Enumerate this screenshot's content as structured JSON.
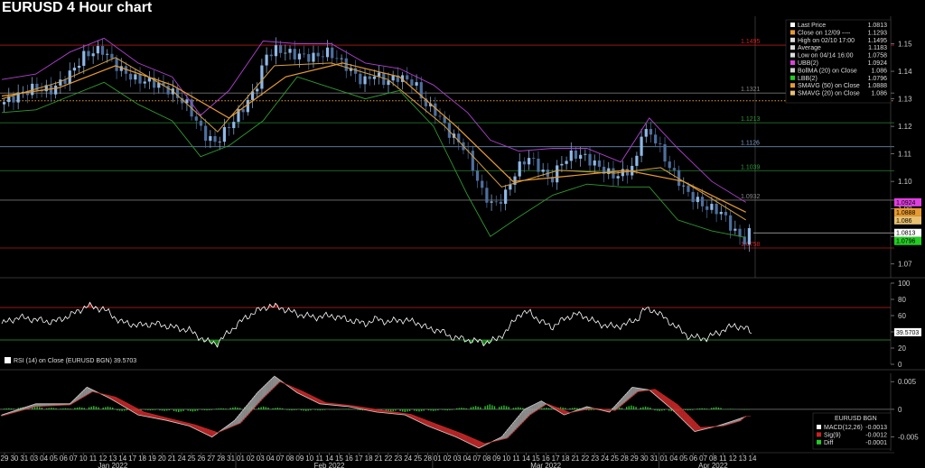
{
  "title": "EURUSD 4 Hour chart",
  "colors": {
    "bg": "#000000",
    "candle_up": "#8fb8e6",
    "candle_dn": "#4d6f9e",
    "bb": "#b040d0",
    "lbb": "#2e9a2e",
    "sma50": "#e89a30",
    "sma20": "#d9a040",
    "close_line": "#e89a30",
    "resistance": "#cc2020",
    "support": "#2f9a3a",
    "rsi_line": "#ffffff",
    "macd": "#aaaaaa",
    "sig": "#c82828",
    "diff": "#22c022"
  },
  "legend": {
    "items": [
      {
        "label": "Last Price",
        "value": "1.0813",
        "color": "#ffffff"
      },
      {
        "label": "Close on 12/09 ----",
        "value": "1.1293",
        "color": "#e89a30"
      },
      {
        "label": "High on 02/10 17:00",
        "value": "1.1495",
        "color": "#dddddd"
      },
      {
        "label": "Average",
        "value": "1.1183",
        "color": "#dddddd"
      },
      {
        "label": "Low on 04/14 16:00",
        "value": "1.0758",
        "color": "#dddddd"
      },
      {
        "label": "UBB(2)",
        "value": "1.0924",
        "color": "#e040e0"
      },
      {
        "label": "BollMA (20)  on Close",
        "value": "1.086",
        "color": "#d0d0d0"
      },
      {
        "label": "LBB(2)",
        "value": "1.0796",
        "color": "#22cc22"
      },
      {
        "label": "SMAVG (50)  on Close",
        "value": "1.0888",
        "color": "#e89a30"
      },
      {
        "label": "SMAVG (20)  on Close",
        "value": "1.086",
        "color": "#e8c070"
      }
    ]
  },
  "rsi_label": "RSI (14)  on Close (EURUSD BGN) 39.5703",
  "rsi_value_tag": "39.5703",
  "macd_legend": {
    "title": "EURUSD BGN",
    "items": [
      {
        "label": "MACD(12,26)",
        "value": "-0.0013",
        "color": "#ffffff"
      },
      {
        "label": "Sig(9)",
        "value": "-0.0012",
        "color": "#cc2020"
      },
      {
        "label": "Diff",
        "value": "-0.0001",
        "color": "#22cc22"
      }
    ]
  },
  "chart_data": [
    {
      "type": "candlestick",
      "title": "EURUSD 4 Hour chart",
      "ylim": [
        1.065,
        1.16
      ],
      "yticks": [
        "1.15",
        "1.14",
        "1.13",
        "1.12",
        "1.11",
        "1.10",
        "1.09",
        "1.08",
        "1.07"
      ],
      "ytick_values": [
        1.15,
        1.14,
        1.13,
        1.12,
        1.11,
        1.1,
        1.09,
        1.08,
        1.07
      ],
      "horizontal_levels": [
        {
          "label": "1.1495",
          "value": 1.1495,
          "color": "#cc2020"
        },
        {
          "label": "1.1321",
          "value": 1.1321,
          "color": "#888888"
        },
        {
          "label": "1.1213",
          "value": 1.1213,
          "color": "#2f9a3a"
        },
        {
          "label": "1.1126",
          "value": 1.1126,
          "color": "#7aa0c8"
        },
        {
          "label": "1.1039",
          "value": 1.1039,
          "color": "#2f9a3a"
        },
        {
          "label": "1.0932",
          "value": 1.0932,
          "color": "#888888"
        },
        {
          "label": "1.0758",
          "value": 1.0758,
          "color": "#cc2020"
        }
      ],
      "close_dotted": 1.1293,
      "last_price": 1.0813,
      "right_tags": [
        {
          "label": "1.0924",
          "value": 1.0924,
          "color": "#e040e0"
        },
        {
          "label": "1.0888",
          "value": 1.0888,
          "color": "#e89a30"
        },
        {
          "label": "1.086",
          "value": 1.086,
          "color": "#e8c070"
        },
        {
          "label": "1.0813",
          "value": 1.0813,
          "color": "#ffffff"
        },
        {
          "label": "1.0796",
          "value": 1.0796,
          "color": "#22cc22"
        }
      ],
      "price_path": [
        [
          0,
          1.128
        ],
        [
          6,
          1.131
        ],
        [
          12,
          1.134
        ],
        [
          18,
          1.133
        ],
        [
          24,
          1.138
        ],
        [
          30,
          1.146
        ],
        [
          36,
          1.148
        ],
        [
          42,
          1.141
        ],
        [
          48,
          1.137
        ],
        [
          54,
          1.136
        ],
        [
          60,
          1.133
        ],
        [
          66,
          1.128
        ],
        [
          72,
          1.117
        ],
        [
          76,
          1.114
        ],
        [
          80,
          1.119
        ],
        [
          86,
          1.127
        ],
        [
          90,
          1.133
        ],
        [
          94,
          1.146
        ],
        [
          98,
          1.148
        ],
        [
          104,
          1.146
        ],
        [
          110,
          1.145
        ],
        [
          116,
          1.147
        ],
        [
          122,
          1.142
        ],
        [
          128,
          1.136
        ],
        [
          132,
          1.139
        ],
        [
          136,
          1.136
        ],
        [
          140,
          1.138
        ],
        [
          146,
          1.136
        ],
        [
          150,
          1.128
        ],
        [
          154,
          1.125
        ],
        [
          158,
          1.118
        ],
        [
          164,
          1.112
        ],
        [
          170,
          1.096
        ],
        [
          174,
          1.091
        ],
        [
          178,
          1.095
        ],
        [
          182,
          1.104
        ],
        [
          186,
          1.109
        ],
        [
          190,
          1.105
        ],
        [
          194,
          1.1
        ],
        [
          198,
          1.107
        ],
        [
          202,
          1.11
        ],
        [
          206,
          1.109
        ],
        [
          210,
          1.106
        ],
        [
          216,
          1.102
        ],
        [
          220,
          1.103
        ],
        [
          224,
          1.106
        ],
        [
          226,
          1.118
        ],
        [
          230,
          1.117
        ],
        [
          236,
          1.105
        ],
        [
          242,
          1.096
        ],
        [
          248,
          1.091
        ],
        [
          254,
          1.089
        ],
        [
          258,
          1.083
        ],
        [
          262,
          1.078
        ],
        [
          264,
          1.0813
        ]
      ],
      "ubb_path": [
        [
          0,
          1.137
        ],
        [
          12,
          1.139
        ],
        [
          24,
          1.147
        ],
        [
          36,
          1.152
        ],
        [
          48,
          1.143
        ],
        [
          60,
          1.138
        ],
        [
          70,
          1.124
        ],
        [
          80,
          1.133
        ],
        [
          92,
          1.151
        ],
        [
          104,
          1.15
        ],
        [
          116,
          1.15
        ],
        [
          128,
          1.143
        ],
        [
          140,
          1.141
        ],
        [
          152,
          1.135
        ],
        [
          164,
          1.125
        ],
        [
          172,
          1.115
        ],
        [
          182,
          1.111
        ],
        [
          194,
          1.112
        ],
        [
          206,
          1.112
        ],
        [
          218,
          1.107
        ],
        [
          228,
          1.123
        ],
        [
          238,
          1.112
        ],
        [
          250,
          1.1
        ],
        [
          262,
          1.0924
        ]
      ],
      "lbb_path": [
        [
          0,
          1.125
        ],
        [
          12,
          1.126
        ],
        [
          24,
          1.131
        ],
        [
          36,
          1.136
        ],
        [
          48,
          1.128
        ],
        [
          60,
          1.122
        ],
        [
          70,
          1.109
        ],
        [
          80,
          1.113
        ],
        [
          92,
          1.122
        ],
        [
          104,
          1.138
        ],
        [
          116,
          1.134
        ],
        [
          128,
          1.13
        ],
        [
          140,
          1.133
        ],
        [
          152,
          1.12
        ],
        [
          164,
          1.095
        ],
        [
          172,
          1.08
        ],
        [
          182,
          1.087
        ],
        [
          194,
          1.095
        ],
        [
          206,
          1.099
        ],
        [
          218,
          1.098
        ],
        [
          228,
          1.098
        ],
        [
          238,
          1.086
        ],
        [
          250,
          1.082
        ],
        [
          262,
          1.0796
        ]
      ],
      "sma50_path": [
        [
          0,
          1.131
        ],
        [
          20,
          1.134
        ],
        [
          40,
          1.142
        ],
        [
          60,
          1.135
        ],
        [
          80,
          1.123
        ],
        [
          100,
          1.138
        ],
        [
          120,
          1.143
        ],
        [
          140,
          1.138
        ],
        [
          160,
          1.12
        ],
        [
          180,
          1.1
        ],
        [
          200,
          1.102
        ],
        [
          220,
          1.104
        ],
        [
          240,
          1.1
        ],
        [
          262,
          1.0888
        ]
      ],
      "sma20_path": [
        [
          0,
          1.13
        ],
        [
          20,
          1.136
        ],
        [
          40,
          1.145
        ],
        [
          60,
          1.133
        ],
        [
          76,
          1.118
        ],
        [
          96,
          1.142
        ],
        [
          116,
          1.143
        ],
        [
          136,
          1.137
        ],
        [
          156,
          1.12
        ],
        [
          176,
          1.098
        ],
        [
          196,
          1.104
        ],
        [
          216,
          1.103
        ],
        [
          232,
          1.105
        ],
        [
          248,
          1.095
        ],
        [
          262,
          1.086
        ]
      ]
    },
    {
      "type": "line",
      "title": "RSI (14)  on Close (EURUSD BGN) 39.5703",
      "ylim": [
        0,
        100
      ],
      "yticks": [
        "100",
        "80",
        "60",
        "40",
        "20",
        "0"
      ],
      "ytick_values": [
        100,
        80,
        60,
        40,
        20,
        0
      ],
      "levels": [
        {
          "value": 70,
          "color": "#cc2020"
        },
        {
          "value": 30,
          "color": "#2f9a3a"
        }
      ],
      "path": [
        [
          0,
          50
        ],
        [
          6,
          58
        ],
        [
          12,
          55
        ],
        [
          18,
          52
        ],
        [
          24,
          60
        ],
        [
          30,
          72
        ],
        [
          36,
          68
        ],
        [
          42,
          52
        ],
        [
          48,
          48
        ],
        [
          54,
          50
        ],
        [
          60,
          46
        ],
        [
          66,
          42
        ],
        [
          72,
          28
        ],
        [
          76,
          26
        ],
        [
          80,
          40
        ],
        [
          86,
          58
        ],
        [
          90,
          66
        ],
        [
          94,
          72
        ],
        [
          98,
          70
        ],
        [
          104,
          62
        ],
        [
          110,
          58
        ],
        [
          116,
          60
        ],
        [
          122,
          55
        ],
        [
          128,
          50
        ],
        [
          132,
          56
        ],
        [
          136,
          52
        ],
        [
          140,
          55
        ],
        [
          146,
          52
        ],
        [
          150,
          44
        ],
        [
          154,
          42
        ],
        [
          158,
          34
        ],
        [
          164,
          30
        ],
        [
          170,
          27
        ],
        [
          174,
          30
        ],
        [
          178,
          42
        ],
        [
          182,
          62
        ],
        [
          186,
          64
        ],
        [
          190,
          52
        ],
        [
          194,
          46
        ],
        [
          198,
          56
        ],
        [
          202,
          62
        ],
        [
          206,
          58
        ],
        [
          210,
          50
        ],
        [
          216,
          46
        ],
        [
          220,
          50
        ],
        [
          224,
          56
        ],
        [
          226,
          68
        ],
        [
          230,
          66
        ],
        [
          236,
          50
        ],
        [
          242,
          34
        ],
        [
          248,
          32
        ],
        [
          254,
          42
        ],
        [
          258,
          48
        ],
        [
          262,
          44
        ],
        [
          264,
          39.57
        ]
      ]
    },
    {
      "type": "bar",
      "title": "EURUSD BGN",
      "ylim": [
        -0.0075,
        0.0065
      ],
      "yticks": [
        "0.005",
        "0",
        "-0.005"
      ],
      "ytick_values": [
        0.005,
        0,
        -0.005
      ],
      "macd_path": [
        [
          0,
          -0.001
        ],
        [
          12,
          0.001
        ],
        [
          24,
          0.001
        ],
        [
          30,
          0.004
        ],
        [
          38,
          0.002
        ],
        [
          48,
          -0.001
        ],
        [
          58,
          -0.002
        ],
        [
          66,
          -0.003
        ],
        [
          74,
          -0.005
        ],
        [
          82,
          -0.002
        ],
        [
          90,
          0.003
        ],
        [
          96,
          0.006
        ],
        [
          104,
          0.003
        ],
        [
          112,
          0.001
        ],
        [
          122,
          0.0005
        ],
        [
          132,
          -0.0005
        ],
        [
          142,
          -0.001
        ],
        [
          150,
          -0.003
        ],
        [
          160,
          -0.005
        ],
        [
          168,
          -0.007
        ],
        [
          176,
          -0.005
        ],
        [
          184,
          0.0
        ],
        [
          190,
          0.0015
        ],
        [
          198,
          -0.001
        ],
        [
          206,
          0.0005
        ],
        [
          214,
          -0.0005
        ],
        [
          222,
          0.004
        ],
        [
          228,
          0.0035
        ],
        [
          236,
          0.0
        ],
        [
          244,
          -0.004
        ],
        [
          252,
          -0.003
        ],
        [
          258,
          -0.002
        ],
        [
          262,
          -0.0013
        ]
      ],
      "sig_path": [
        [
          0,
          -0.0012
        ],
        [
          12,
          0.0005
        ],
        [
          24,
          0.0008
        ],
        [
          32,
          0.0032
        ],
        [
          40,
          0.0022
        ],
        [
          50,
          -0.0005
        ],
        [
          60,
          -0.0018
        ],
        [
          68,
          -0.0028
        ],
        [
          76,
          -0.0042
        ],
        [
          84,
          -0.0025
        ],
        [
          92,
          0.002
        ],
        [
          98,
          0.005
        ],
        [
          106,
          0.0032
        ],
        [
          114,
          0.0012
        ],
        [
          124,
          0.0006
        ],
        [
          134,
          -0.0002
        ],
        [
          144,
          -0.0009
        ],
        [
          152,
          -0.0025
        ],
        [
          162,
          -0.0044
        ],
        [
          170,
          -0.0062
        ],
        [
          178,
          -0.0052
        ],
        [
          186,
          -0.001
        ],
        [
          192,
          0.001
        ],
        [
          200,
          -0.0006
        ],
        [
          208,
          0.0002
        ],
        [
          216,
          -0.0002
        ],
        [
          224,
          0.0032
        ],
        [
          230,
          0.0036
        ],
        [
          238,
          0.0008
        ],
        [
          246,
          -0.0033
        ],
        [
          254,
          -0.003
        ],
        [
          260,
          -0.0021
        ],
        [
          262,
          -0.0012
        ]
      ],
      "diff": [
        0.0002,
        0.0004,
        0.0005,
        0.0003,
        0.0002,
        0.0004,
        0.0006,
        0.0005,
        -0.0003,
        -0.0004,
        -0.0002,
        -0.0003,
        -0.0005,
        -0.0004,
        -0.0002,
        0.0002,
        0.0004,
        0.0006,
        0.0005,
        0.0003,
        -0.0002,
        -0.0003,
        -0.0002,
        -0.0001,
        0.0001,
        -0.0002,
        -0.0003,
        -0.0004,
        -0.0005,
        -0.0004,
        -0.0003,
        -0.0002,
        0.0003,
        0.0006,
        0.0009,
        0.0007,
        0.0004,
        -0.0002,
        0.0003,
        0.0004,
        0.0003,
        -0.0002,
        -0.0001,
        0.0004,
        0.0007,
        0.0005,
        -0.0003,
        -0.0004,
        -0.0002,
        0.0002,
        0.0004,
        0.0001,
        -0.0001
      ]
    }
  ],
  "x_axis": {
    "days": [
      "29",
      "30",
      "31",
      "03",
      "04",
      "05",
      "06",
      "07",
      "10",
      "11",
      "12",
      "13",
      "14",
      "17",
      "18",
      "19",
      "20",
      "21",
      "24",
      "25",
      "26",
      "27",
      "28",
      "31",
      "01",
      "02",
      "03",
      "04",
      "07",
      "08",
      "09",
      "10",
      "11",
      "14",
      "15",
      "16",
      "17",
      "18",
      "21",
      "22",
      "23",
      "24",
      "25",
      "28",
      "01",
      "02",
      "03",
      "04",
      "07",
      "08",
      "09",
      "10",
      "11",
      "14",
      "15",
      "16",
      "17",
      "18",
      "21",
      "22",
      "23",
      "24",
      "25",
      "28",
      "29",
      "30",
      "31",
      "01",
      "04",
      "05",
      "06",
      "07",
      "08",
      "11",
      "12",
      "13",
      "14"
    ],
    "months": [
      {
        "label": "Jan 2022",
        "day_index": 11
      },
      {
        "label": "Feb 2022",
        "day_index": 33
      },
      {
        "label": "Mar 2022",
        "day_index": 55
      },
      {
        "label": "Apr 2022",
        "day_index": 72
      }
    ]
  }
}
